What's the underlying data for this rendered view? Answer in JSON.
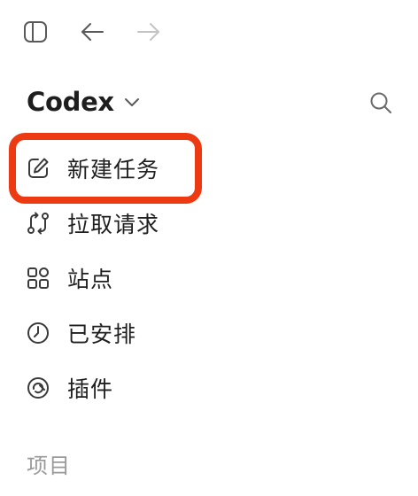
{
  "toolbar": {
    "sidebar_toggle_icon": "sidebar-toggle-icon",
    "back_icon": "arrow-left-icon",
    "forward_icon": "arrow-right-icon"
  },
  "header": {
    "app_name": "Codex",
    "dropdown_icon": "chevron-down-icon",
    "search_icon": "search-icon"
  },
  "nav": {
    "items": [
      {
        "label": "新建任务",
        "icon": "edit-icon",
        "highlighted": true
      },
      {
        "label": "拉取请求",
        "icon": "pull-request-icon",
        "highlighted": false
      },
      {
        "label": "站点",
        "icon": "grid-icon",
        "highlighted": false
      },
      {
        "label": "已安排",
        "icon": "clock-icon",
        "highlighted": false
      },
      {
        "label": "插件",
        "icon": "plugin-icon",
        "highlighted": false
      }
    ]
  },
  "sections": {
    "projects_label": "项目"
  },
  "colors": {
    "highlight": "#ee3a13",
    "text": "#1f1f1f",
    "muted": "#9a9a9a",
    "icon_disabled": "#c4c4c4"
  }
}
